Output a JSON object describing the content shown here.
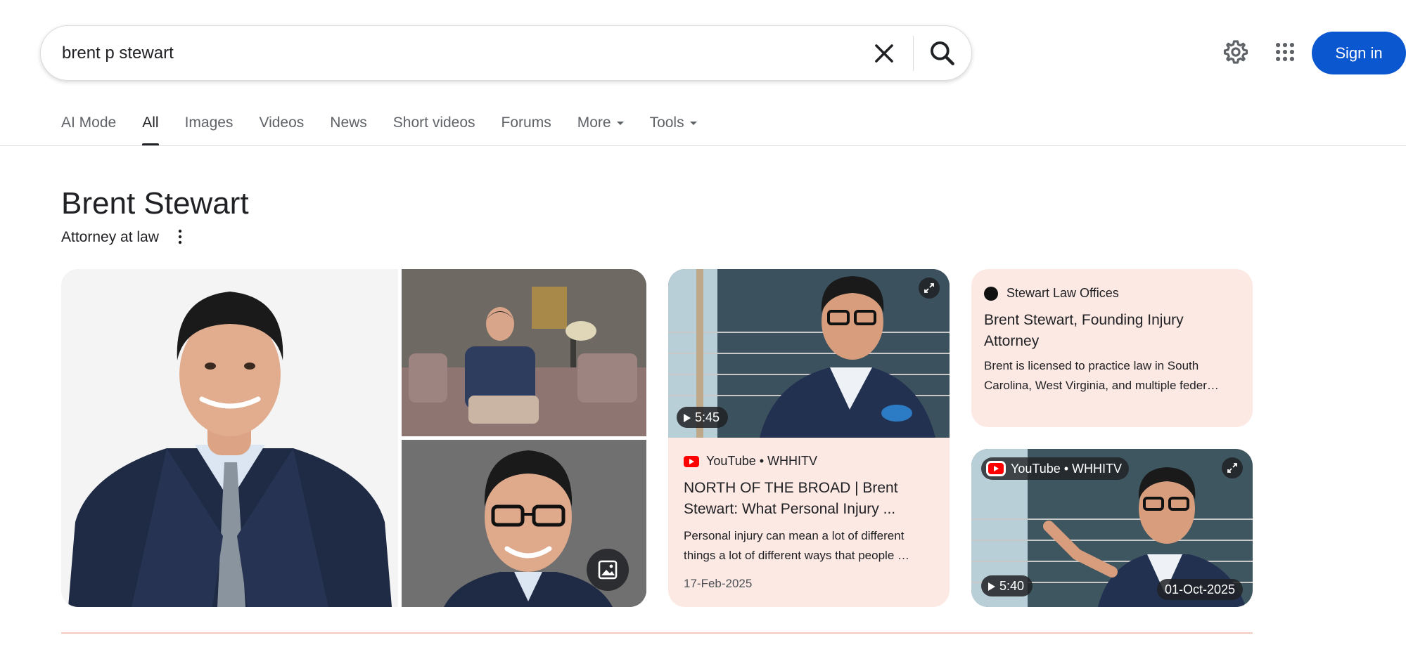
{
  "search": {
    "query": "brent p stewart"
  },
  "header": {
    "sign_in_label": "Sign in",
    "icons": [
      "clear-icon",
      "search-icon",
      "settings-gear-icon",
      "apps-grid-icon"
    ]
  },
  "tabs": [
    {
      "label": "AI Mode"
    },
    {
      "label": "All",
      "active": true
    },
    {
      "label": "Images"
    },
    {
      "label": "Videos"
    },
    {
      "label": "News"
    },
    {
      "label": "Short videos"
    },
    {
      "label": "Forums"
    },
    {
      "label": "More",
      "dropdown": true
    },
    {
      "label": "Tools",
      "dropdown": true
    }
  ],
  "knowledge_panel": {
    "title": "Brent Stewart",
    "subtitle": "Attorney at law"
  },
  "video_card": {
    "duration": "5:45",
    "source": "YouTube • WHHITV",
    "title": "NORTH OF THE BROAD | Brent Stewart: What Personal Injury ...",
    "snippet": "Personal injury can mean a lot of different things a lot of different ways that people …",
    "date": "17-Feb-2025"
  },
  "article_card": {
    "source": "Stewart Law Offices",
    "title": "Brent Stewart, Founding Injury Attorney",
    "snippet": "Brent is licensed to practice law in South Carolina, West Virginia, and multiple feder…"
  },
  "video2_card": {
    "source": "YouTube • WHHITV",
    "duration": "5:40",
    "date": "01-Oct-2025"
  },
  "colors": {
    "accent_blue": "#0b57d0",
    "card_bg": "#fde9e4",
    "youtube_red": "#ff0000",
    "rule": "#f6c9bd"
  }
}
